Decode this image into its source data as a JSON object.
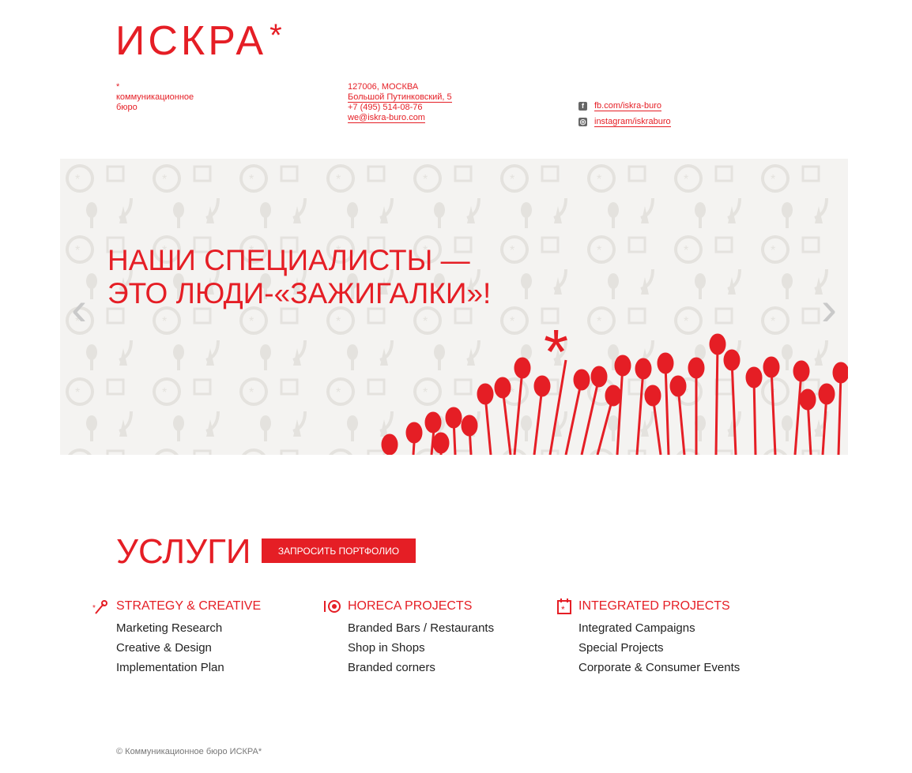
{
  "logo": {
    "text": "ИСКРА",
    "star": "*"
  },
  "tagline": {
    "star": "*",
    "line1": "коммуникационное",
    "line2": "бюро"
  },
  "contacts": {
    "index_city": "127006, МОСКВА",
    "address": "Большой Путинковский, 5",
    "phone": "+7 (495) 514-08-76",
    "email": "we@iskra-buro.com"
  },
  "social": {
    "fb": {
      "label": "fb.com/iskra-buro",
      "icon": "facebook-icon"
    },
    "instagram": {
      "label": "instagram/iskraburo",
      "icon": "instagram-icon"
    }
  },
  "slider": {
    "title_line1": "НАШИ СПЕЦИАЛИСТЫ —",
    "title_line2": "ЭТО ЛЮДИ-«ЗАЖИГАЛКИ»!",
    "prev_icon": "chevron-left-icon",
    "next_icon": "chevron-right-icon"
  },
  "services": {
    "title": "УСЛУГИ",
    "portfolio_button": "ЗАПРОСИТЬ ПОРТФОЛИО",
    "columns": [
      {
        "title": "STRATEGY & CREATIVE",
        "icon": "match-spark-icon",
        "items": [
          "Marketing Research",
          "Creative & Design",
          "Implementation Plan"
        ]
      },
      {
        "title": "HORECA PROJECTS",
        "icon": "plate-cutlery-icon",
        "items": [
          "Branded Bars / Restaurants",
          "Shop in Shops",
          "Branded corners"
        ]
      },
      {
        "title": "INTEGRATED PROJECTS",
        "icon": "calendar-icon",
        "items": [
          "Integrated Campaigns",
          "Special Projects",
          "Corporate & Consumer Events"
        ]
      }
    ]
  },
  "footer": {
    "copyright": "© Коммуникационное бюро ИСКРА*"
  },
  "colors": {
    "brand": "#e51e25",
    "text": "#222222",
    "slider_bg": "#f4f3f1"
  }
}
